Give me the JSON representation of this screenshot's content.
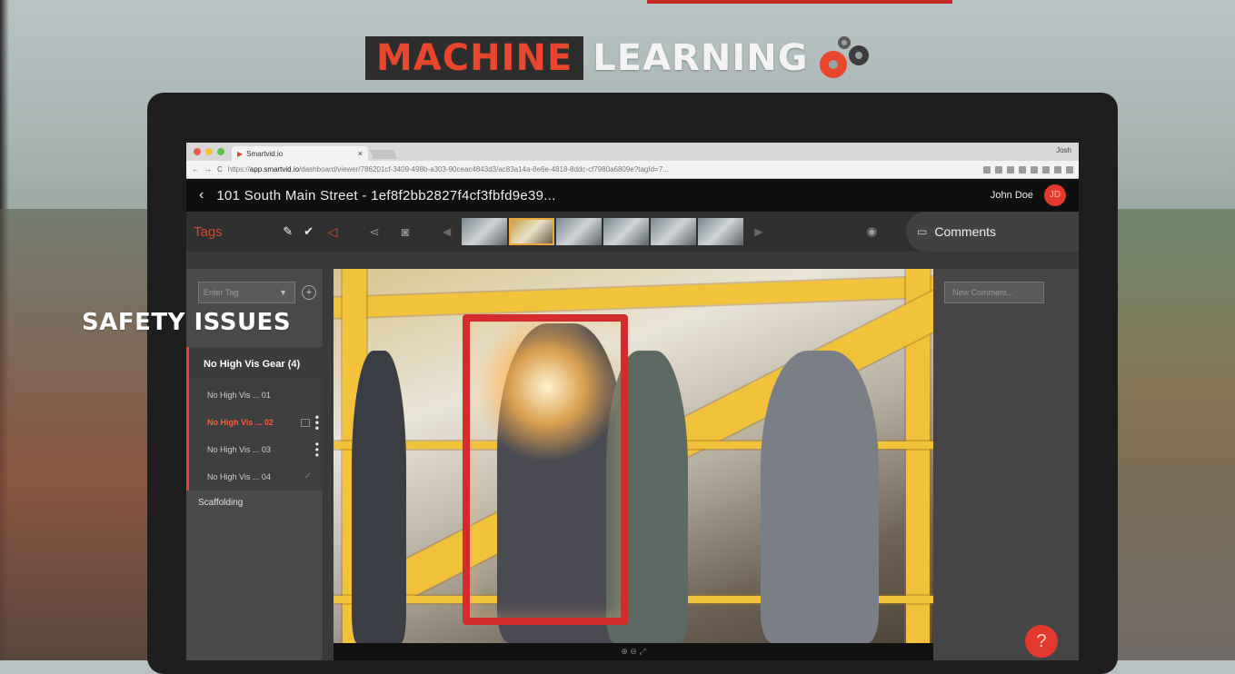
{
  "headline": {
    "word1": "MACHINE",
    "word2": "LEARNING"
  },
  "overlay": {
    "safety_label": "SAFETY ISSUES"
  },
  "browser": {
    "tab_title": "Smartvid.io",
    "profile": "Josh",
    "url_prefix": "https://",
    "url_host": "app.smartvid.io",
    "url_rest": "/dashboard/viewer/786201cf-3409-498b-a303-90ceac4843d3/ac83a14a-8e6e-4818-8ddc-cf7980a6809e?tagId=7..."
  },
  "app": {
    "title": "101 South Main Street - 1ef8f2bb2827f4cf3fbfd9e39...",
    "user_name": "John Doe",
    "user_initials": "JD"
  },
  "toolbar": {
    "tags_label": "Tags",
    "comments_label": "Comments"
  },
  "sidebar": {
    "tag_input_placeholder": "Enter Tag",
    "group_label": "No High Vis Gear (4)",
    "items": [
      {
        "label": "No High Vis ... 01"
      },
      {
        "label": "No High Vis ... 02"
      },
      {
        "label": "No High Vis ... 03"
      },
      {
        "label": "No High Vis ... 04"
      }
    ],
    "other_tag": "Scaffolding"
  },
  "comments": {
    "input_placeholder": "New Comment..."
  },
  "help": {
    "label": "?"
  },
  "colors": {
    "accent": "#e8472d",
    "dark": "#1e1e1f",
    "panel": "#4a4a4a"
  },
  "icons": [
    "back-icon",
    "pencil-icon",
    "check-icon",
    "mute-icon",
    "share-icon",
    "camera-icon",
    "projector-icon",
    "comment-icon",
    "plus-icon",
    "flag-icon",
    "more-icon",
    "zoom-in-icon",
    "zoom-out-icon",
    "fullscreen-icon",
    "help-icon"
  ]
}
